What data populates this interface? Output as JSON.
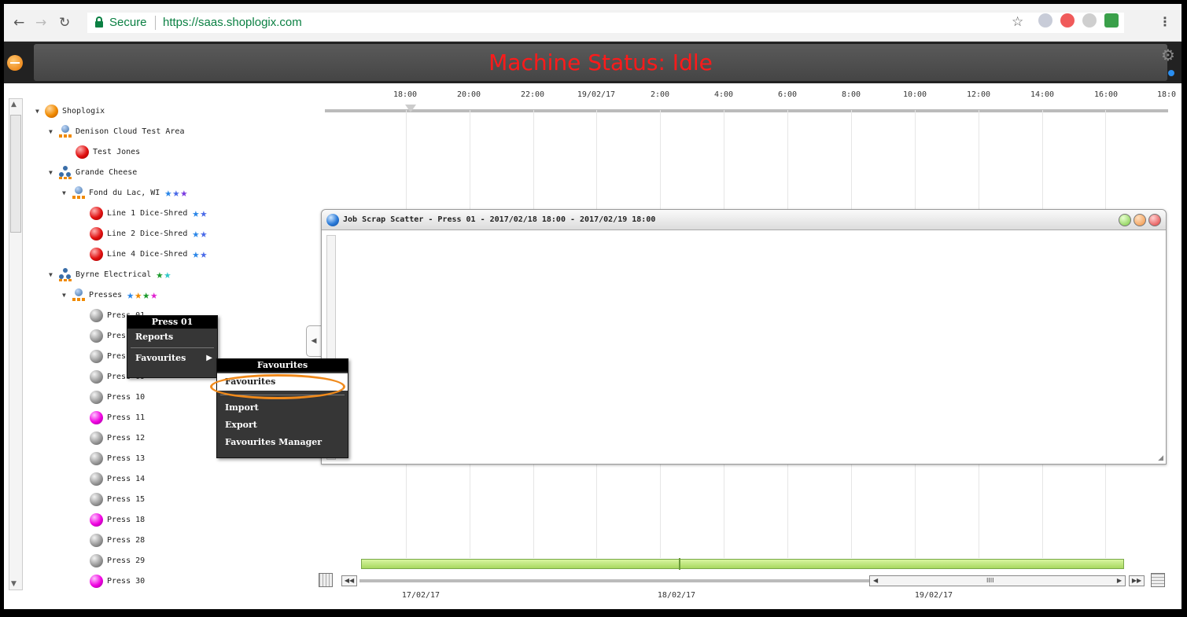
{
  "browser": {
    "secure_label": "Secure",
    "url": "https://saas.shoplogix.com"
  },
  "app": {
    "title": "Machine Status: Idle"
  },
  "tree": {
    "root": "Shoplogix",
    "nodes": [
      {
        "label": "Denison Cloud Test Area"
      },
      {
        "label": "Test Jones"
      },
      {
        "label": "Grande Cheese"
      },
      {
        "label": "Fond du Lac, WI"
      },
      {
        "label": "Line 1 Dice-Shred"
      },
      {
        "label": "Line 2 Dice-Shred"
      },
      {
        "label": "Line 4 Dice-Shred"
      },
      {
        "label": "Byrne Electrical"
      },
      {
        "label": "Presses"
      },
      {
        "label": "Press 01"
      },
      {
        "label": "Press"
      },
      {
        "label": "Press 08"
      },
      {
        "label": "Press 09"
      },
      {
        "label": "Press 10"
      },
      {
        "label": "Press 11"
      },
      {
        "label": "Press 12"
      },
      {
        "label": "Press 13"
      },
      {
        "label": "Press 14"
      },
      {
        "label": "Press 15"
      },
      {
        "label": "Press 18"
      },
      {
        "label": "Press 28"
      },
      {
        "label": "Press 29"
      },
      {
        "label": "Press 30"
      }
    ]
  },
  "timeline": {
    "ticks": [
      "18:00",
      "20:00",
      "22:00",
      "19/02/17",
      "2:00",
      "4:00",
      "6:00",
      "8:00",
      "10:00",
      "12:00",
      "14:00",
      "16:00",
      "18:0"
    ]
  },
  "scrap_window": {
    "title": "Job Scrap Scatter - Press 01 - 2017/02/18 18:00 - 2017/02/19 18:00"
  },
  "context_menu": {
    "header": "Press 01",
    "items": [
      "Reports",
      "Favourites"
    ]
  },
  "favourites_menu": {
    "header": "Favourites",
    "highlighted": "Favourites",
    "items": [
      "Import",
      "Export",
      "Favourites Manager"
    ]
  },
  "navigator": {
    "dates": [
      "17/02/17",
      "18/02/17",
      "19/02/17"
    ]
  },
  "colors": {
    "title_red": "#ff1a1a",
    "secure_green": "#0b8043",
    "highlight_orange": "#f08a1c"
  }
}
